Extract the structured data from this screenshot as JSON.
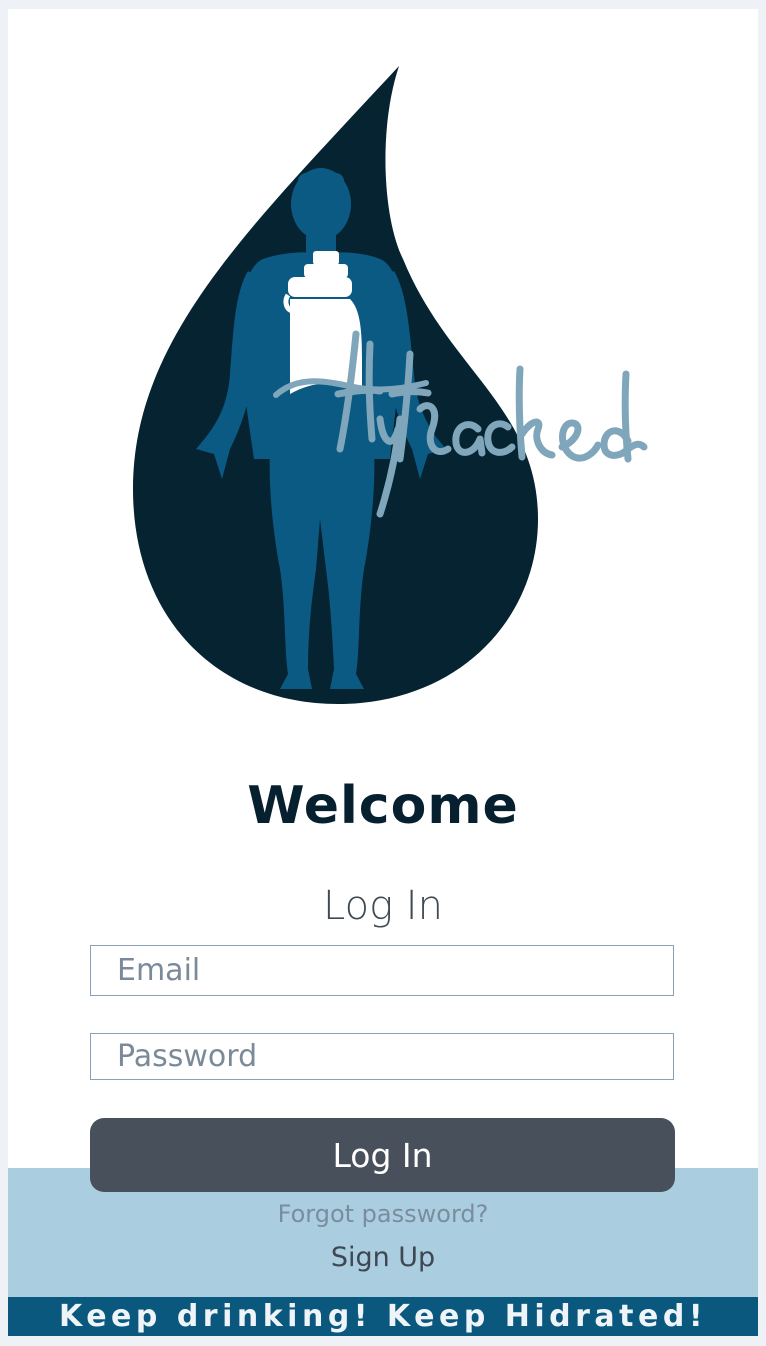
{
  "logo": {
    "name": "Hytracked",
    "colors": {
      "drop": "#052331",
      "body": "#0b5a84",
      "bottle": "#ffffff",
      "script": "#7fa6ba"
    }
  },
  "welcome": {
    "title": "Welcome"
  },
  "login_form": {
    "heading": "Log In",
    "email_placeholder": "Email",
    "password_placeholder": "Password",
    "submit_label": "Log In",
    "forgot_password_label": "Forgot password?",
    "signup_label": "Sign Up"
  },
  "footer": {
    "tagline": "Keep drinking! Keep Hidrated!"
  },
  "colors": {
    "background": "#eef2f7",
    "card": "#ffffff",
    "band": "#abcde0",
    "footer": "#0b587f",
    "button": "#48515b",
    "heading": "#06202f"
  }
}
